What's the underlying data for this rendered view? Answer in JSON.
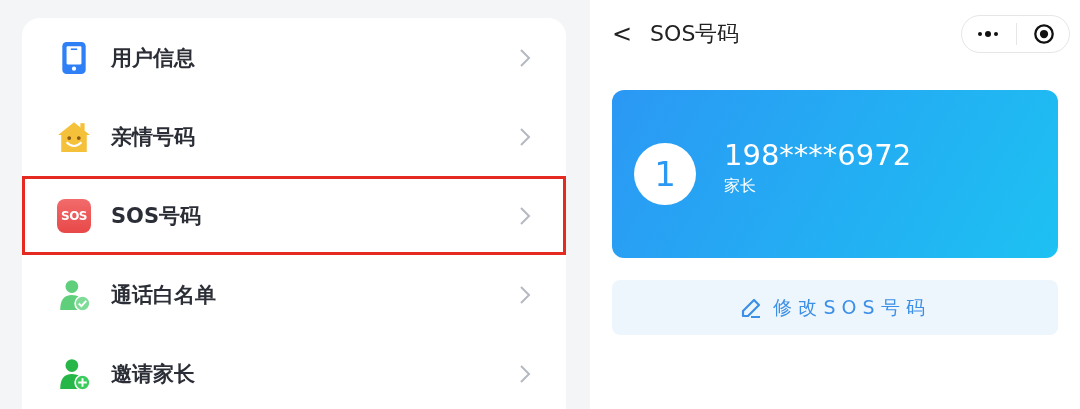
{
  "settings_menu": {
    "items": [
      {
        "label": "用户信息",
        "kind": "phone",
        "highlighted": false
      },
      {
        "label": "亲情号码",
        "kind": "house",
        "highlighted": false
      },
      {
        "label": "SOS号码",
        "kind": "sos",
        "icon_text": "SOS",
        "highlighted": true
      },
      {
        "label": "通话白名单",
        "kind": "person-check",
        "highlighted": false
      },
      {
        "label": "邀请家长",
        "kind": "person-add",
        "highlighted": false
      }
    ]
  },
  "sos_page": {
    "title": "SOS号码",
    "back": "<",
    "contacts": [
      {
        "index": "1",
        "number": "198****6972",
        "relation": "家长"
      }
    ],
    "edit_button": "修改SOS号码"
  }
}
